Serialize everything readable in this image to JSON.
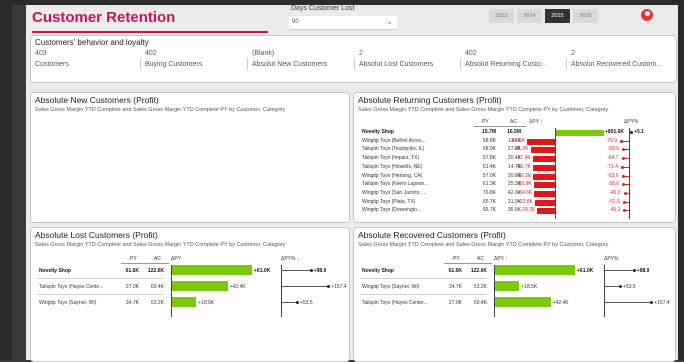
{
  "header": {
    "title": "Customer Retention",
    "slicer_label": "Days Customer Lost",
    "slicer_value": "90",
    "years": [
      "2013",
      "2014",
      "2015",
      "2016"
    ],
    "selected_year": "2015"
  },
  "behavior": {
    "title": "Customers' behavior and loyalty",
    "kpis": [
      {
        "value": "403",
        "label": "Customers"
      },
      {
        "value": "402",
        "label": "Buying Customers"
      },
      {
        "value": "(Blank)",
        "label": "Absolut New Customers"
      },
      {
        "value": "2",
        "label": "Absolut Lost Customers"
      },
      {
        "value": "402",
        "label": "Absolut Returning Custo..."
      },
      {
        "value": "2",
        "label": "Absolut Recovered Custom..."
      }
    ]
  },
  "new_customers": {
    "title": "Absolute New Customers (Profit)",
    "subtitle": "Sales Gross Margin YTD Complete and Sales Gross Margin YTD Complete PY by Customer, Category"
  },
  "returning": {
    "title": "Absolute Returning Customers (Profit)",
    "subtitle": "Sales Gross Margin YTD Complete and Sales Gross Margin YTD Complete PY by Customer, Category",
    "headers": {
      "py": "PY",
      "ac": "AC",
      "dpy": "ΔPY ↑",
      "dpyp": "ΔPY%"
    },
    "rows": [
      {
        "name": "Novelty Shop",
        "py": "15.7M",
        "ac": "16.5M",
        "dpy": "+801.6K",
        "dpyp": "+5.1",
        "dpy_val": 801.6,
        "pct_val": 5.1,
        "bold": true
      },
      {
        "name": "Wingtip Toys (Bethel Acres...",
        "py": "58.8K",
        "ac": "11.6K",
        "dpy": "-46.9K",
        "dpyp": "-79.9",
        "dpy_val": -46.9,
        "pct_val": -79.9
      },
      {
        "name": "Tailspin Toys (Teutopolis, IL)",
        "py": "68.9K",
        "ac": "27.9K",
        "dpy": "-41.0K",
        "dpyp": "-59.6",
        "dpy_val": -41.0,
        "pct_val": -59.6
      },
      {
        "name": "Tailspin Toys (Impact, TX)",
        "py": "57.8K",
        "ac": "20.4K",
        "dpy": "-37.4K",
        "dpyp": "-64.7",
        "dpy_val": -37.4,
        "pct_val": -64.7
      },
      {
        "name": "Tailspin Toys (Howells, NE)",
        "py": "51.4K",
        "ac": "14.7K",
        "dpy": "-36.7K",
        "dpyp": "-71.4",
        "dpy_val": -36.7,
        "pct_val": -71.4
      },
      {
        "name": "Wingtip Toys (Herlong, CA)",
        "py": "57.0K",
        "ac": "20.8K",
        "dpy": "-36.2K",
        "dpyp": "-63.6",
        "dpy_val": -36.2,
        "pct_val": -63.6
      },
      {
        "name": "Tailspin Toys (Keehi Lagoon...",
        "py": "61.3K",
        "ac": "25.3K",
        "dpy": "-35.9K",
        "dpyp": "-58.6",
        "dpy_val": -35.9,
        "pct_val": -58.6
      },
      {
        "name": "Wingtip Toys (San Jacinto, ...",
        "py": "76.8K",
        "ac": "42.3K",
        "dpy": "-34.6K",
        "dpyp": "-45.0",
        "dpy_val": -34.6,
        "pct_val": -45.0
      },
      {
        "name": "Wingtip Toys (Plata, TX)",
        "py": "65.7K",
        "ac": "31.9K",
        "dpy": "-33.8K",
        "dpyp": "-51.5",
        "dpy_val": -33.8,
        "pct_val": -51.5
      },
      {
        "name": "Wingtip Toys (Downingto...",
        "py": "65.7K",
        "ac": "35.9K",
        "dpy": "-29.7K",
        "dpyp": "-45.3",
        "dpy_val": -29.7,
        "pct_val": -45.3
      }
    ]
  },
  "lost": {
    "title": "Absolute Lost Customers (Profit)",
    "subtitle": "Sales Gross Margin YTD Complete and Sales Gross Margin YTD Complete PY by Customer, Category",
    "headers": {
      "py": "PY",
      "ac": "AC",
      "dpy": "ΔPY",
      "dpyp": "ΔPY% ↓"
    },
    "rows": [
      {
        "name": "Novelty Shop",
        "py": "61.6K",
        "ac": "122.6K",
        "dpy": "+61.0K",
        "dpyp": "+98.9",
        "dpy_val": 61.0,
        "pct_val": 98.9,
        "bold": true
      },
      {
        "name": "Tailspin Toys (Hayes Cente...",
        "py": "27.0K",
        "ac": "69.4K",
        "dpy": "+42.4K",
        "dpyp": "+157.4",
        "dpy_val": 42.4,
        "pct_val": 157.4
      },
      {
        "name": "Wingtip Toys (Sayner, WI)",
        "py": "34.7K",
        "ac": "53.2K",
        "dpy": "+18.5K",
        "dpyp": "+53.5",
        "dpy_val": 18.5,
        "pct_val": 53.5
      }
    ]
  },
  "recovered": {
    "title": "Absolute Recovered Customers (Profit)",
    "subtitle": "Sales Gross Margin YTD Complete and Sales Gross Margin YTD Complete PY by Customer, Category",
    "headers": {
      "py": "PY",
      "ac": "AC",
      "dpy": "ΔPY ↑",
      "dpyp": "ΔPY%"
    },
    "rows": [
      {
        "name": "Novelty Shop",
        "py": "61.6K",
        "ac": "122.6K",
        "dpy": "+61.0K",
        "dpyp": "+98.9",
        "dpy_val": 61.0,
        "pct_val": 98.9,
        "bold": true
      },
      {
        "name": "Wingtip Toys (Sayner, WI)",
        "py": "34.7K",
        "ac": "53.2K",
        "dpy": "+18.5K",
        "dpyp": "+53.5",
        "dpy_val": 18.5,
        "pct_val": 53.5
      },
      {
        "name": "Tailspin Toys (Hayes Center...",
        "py": "27.0K",
        "ac": "69.4K",
        "dpy": "+42.4K",
        "dpyp": "+157.4",
        "dpy_val": 42.4,
        "pct_val": 157.4
      }
    ]
  },
  "colors": {
    "accent": "#c2185b",
    "positive": "#7ac70c",
    "negative": "#e0181a"
  }
}
